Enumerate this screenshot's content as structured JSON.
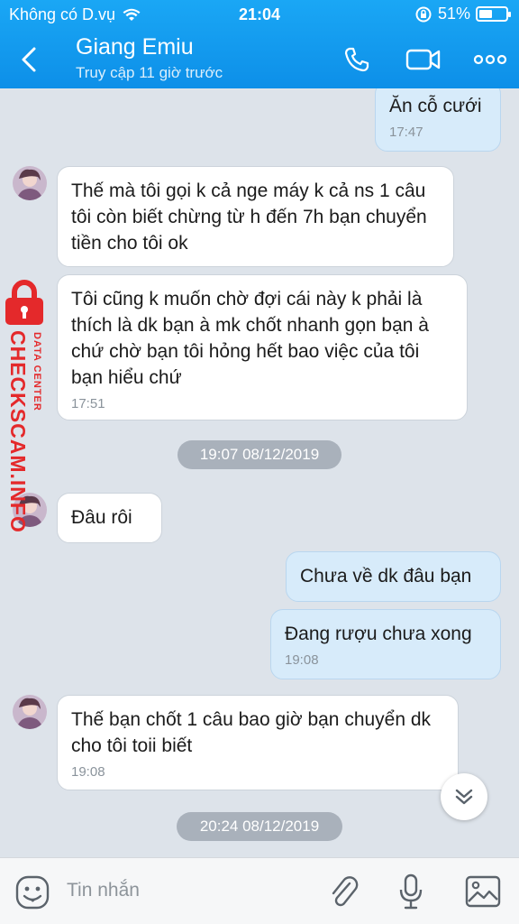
{
  "status_bar": {
    "carrier": "Không có D.vụ",
    "time": "21:04",
    "battery": "51%",
    "battery_level": 0.51
  },
  "header": {
    "title": "Giang Emiu",
    "subtitle": "Truy cập 11 giờ trước"
  },
  "messages": [
    {
      "side": "out",
      "text": "Ăn cỗ cưới",
      "time": "17:47"
    },
    {
      "side": "in",
      "text": "Thế mà tôi gọi k cả nge máy k cả ns 1 câu tôi còn biết chừng từ h đến 7h bạn chuyển tiền cho tôi ok"
    },
    {
      "side": "in",
      "text": "Tôi cũng k muốn chờ đợi cái này k phải là thích là dk bạn à mk chốt nhanh gọn bạn à chứ chờ bạn tôi hỏng hết bao việc của tôi bạn hiểu chứ",
      "time": "17:51"
    },
    {
      "side": "in",
      "text": "Đâu rôi"
    },
    {
      "side": "out",
      "text": "Chưa về dk đâu bạn"
    },
    {
      "side": "out",
      "text": "Đang rượu chưa xong",
      "time": "19:08"
    },
    {
      "side": "in",
      "text": "Thế bạn chốt 1 câu bao giờ bạn chuyển dk cho tôi toii biết",
      "time": "19:08"
    }
  ],
  "date_separators": [
    "19:07 08/12/2019",
    "20:24 08/12/2019"
  ],
  "watermark": {
    "brand": "CHECKSCAM.INFO",
    "tagline": "DATA CENTER"
  },
  "input": {
    "placeholder": "Tin nhắn"
  },
  "icons": [
    "back-icon",
    "phone-icon",
    "video-call-icon",
    "more-icon",
    "chevron-down-icon",
    "emoji-icon",
    "attachment-icon",
    "microphone-icon",
    "image-icon",
    "wifi-icon",
    "rotation-lock-icon",
    "battery-icon",
    "lock-icon"
  ],
  "colors": {
    "header": "#1aa7f5",
    "outgoing_bubble": "#d7ebfa",
    "incoming_bubble": "#ffffff",
    "watermark": "#e4292b"
  }
}
